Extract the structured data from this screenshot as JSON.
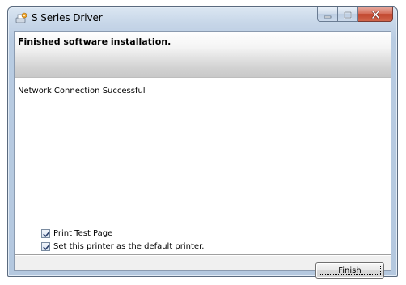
{
  "window": {
    "title": "S Series Driver",
    "app_icon": "printer-setup-icon",
    "caption_buttons": {
      "minimize_icon": "minimize-icon",
      "maximize_icon": "maximize-icon",
      "close_icon": "close-icon"
    }
  },
  "header": {
    "title": "Finished software installation."
  },
  "body": {
    "status": "Network Connection Successful"
  },
  "options": [
    {
      "label": "Print Test Page",
      "checked": true
    },
    {
      "label": "Set this printer as the default printer.",
      "checked": true
    }
  ],
  "footer": {
    "finish_mnemonic": "F",
    "finish_rest": "inish"
  },
  "colors": {
    "title_bar": "#b9cce2",
    "close_button": "#c1462e",
    "header_band_end": "#c9c9c9"
  }
}
